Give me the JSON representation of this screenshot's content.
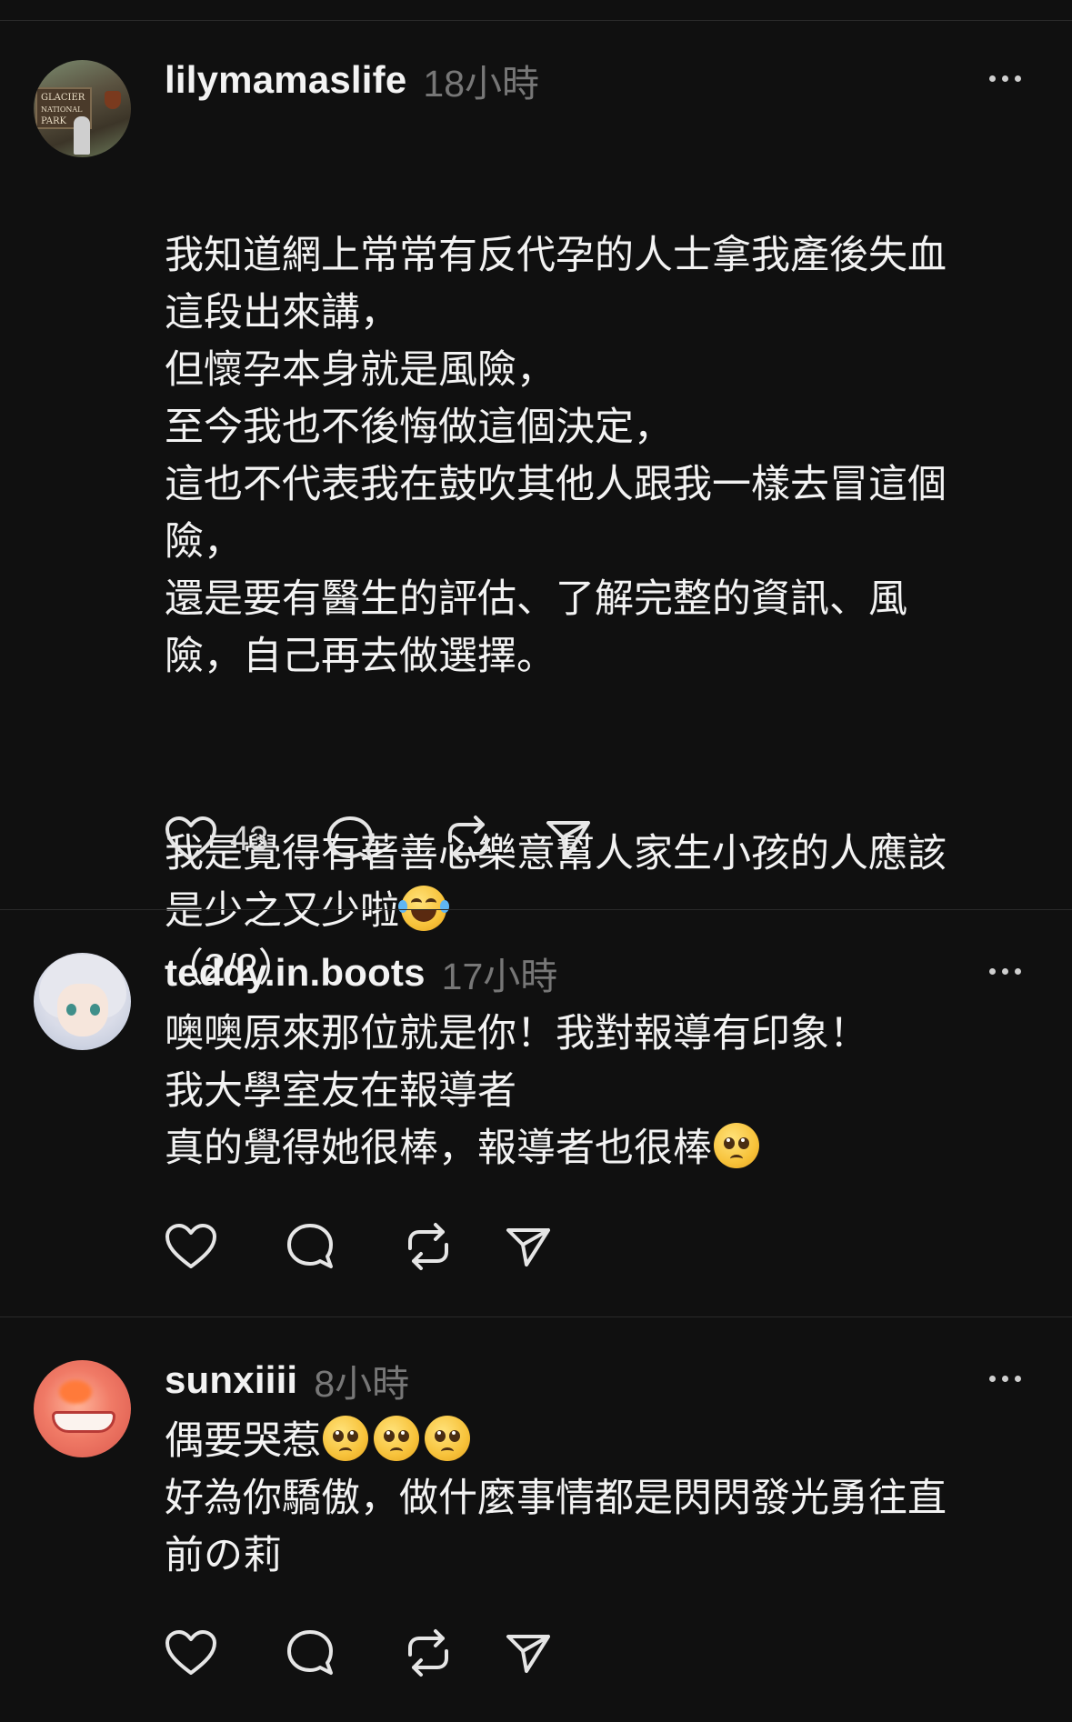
{
  "posts": [
    {
      "username": "lilymamaslife",
      "time": "18小時",
      "avatar_sign_lines": [
        "GLACIER",
        "NATIONAL",
        "PARK"
      ],
      "paragraphs": [
        "我知道網上常常有反代孕的人士拿我產後失血\n這段出來講，\n但懷孕本身就是風險，\n至今我也不後悔做這個決定，\n這也不代表我在鼓吹其他人跟我一樣去冒這個\n險，\n還是要有醫生的評估、了解完整的資訊、風\n險，自己再去做選擇。",
        "我是覺得有著善心樂意幫人家生小孩的人應該\n是少之又少啦"
      ],
      "paragraph_suffix_emoji": "face-with-tears-of-joy",
      "page_marker": "（2/2）",
      "like_count": "43"
    },
    {
      "username": "teddy.in.boots",
      "time": "17小時",
      "text": "噢噢原來那位就是你！我對報導有印象！\n我大學室友在報導者\n真的覺得她很棒，報導者也很棒",
      "text_suffix_emoji": "pleading-face"
    },
    {
      "username": "sunxiiii",
      "time": "8小時",
      "line1": "偶要哭惹",
      "line1_emojis": [
        "pleading-face",
        "pleading-face",
        "pleading-face"
      ],
      "line2": "好為你驕傲，做什麼事情都是閃閃發光勇往直\n前の莉"
    }
  ],
  "icons": {
    "like": "heart-icon",
    "reply": "comment-bubble-icon",
    "repost": "repost-icon",
    "share": "send-icon",
    "more": "more-horizontal-icon"
  },
  "colors": {
    "background": "#101010",
    "text": "#f3f3f3",
    "muted": "#777777",
    "divider": "#2a2a2a"
  }
}
